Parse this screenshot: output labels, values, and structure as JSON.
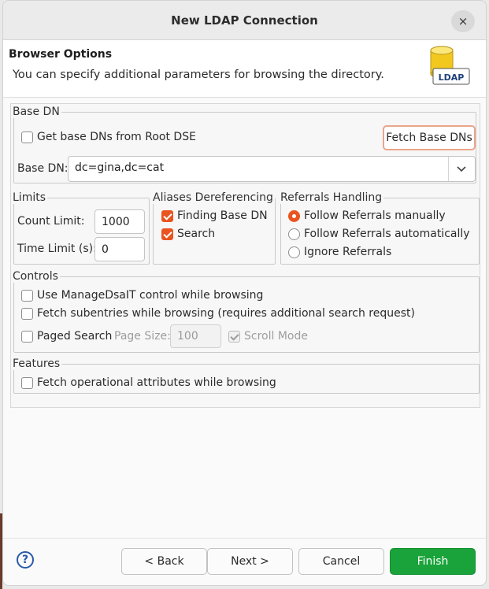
{
  "window": {
    "title": "New LDAP Connection",
    "close_glyph": "×"
  },
  "header": {
    "title": "Browser Options",
    "description": "You can specify additional parameters for browsing the directory.",
    "icon_label": "LDAP"
  },
  "base_dn": {
    "legend": "Base DN",
    "get_from_root_label": "Get base DNs from Root DSE",
    "get_from_root_checked": false,
    "fetch_button": "Fetch Base DNs",
    "field_label": "Base DN:",
    "field_value": "dc=gina,dc=cat"
  },
  "limits": {
    "legend": "Limits",
    "count_label": "Count Limit:",
    "count_value": "1000",
    "time_label": "Time Limit (s):",
    "time_value": "0"
  },
  "aliases": {
    "legend": "Aliases Dereferencing",
    "items": [
      {
        "label": "Finding Base DN",
        "checked": true
      },
      {
        "label": "Search",
        "checked": true
      }
    ]
  },
  "referrals": {
    "legend": "Referrals Handling",
    "options": [
      {
        "label": "Follow Referrals manually",
        "selected": true
      },
      {
        "label": "Follow Referrals automatically",
        "selected": false
      },
      {
        "label": "Ignore Referrals",
        "selected": false
      }
    ]
  },
  "controls": {
    "legend": "Controls",
    "manage_dsait": "Use ManageDsaIT control while browsing",
    "fetch_subentries": "Fetch subentries while browsing (requires additional search request)",
    "paged_search": "Paged Search",
    "page_size_label": "Page Size:",
    "page_size_value": "100",
    "scroll_mode": "Scroll Mode",
    "scroll_mode_checked": true
  },
  "features": {
    "legend": "Features",
    "fetch_operational": "Fetch operational attributes while browsing"
  },
  "footer": {
    "help_glyph": "?",
    "back": "< Back",
    "next": "Next >",
    "cancel": "Cancel",
    "finish": "Finish"
  },
  "colors": {
    "accent": "#e95420",
    "finish": "#1aa33a",
    "help": "#2a5aa8"
  }
}
